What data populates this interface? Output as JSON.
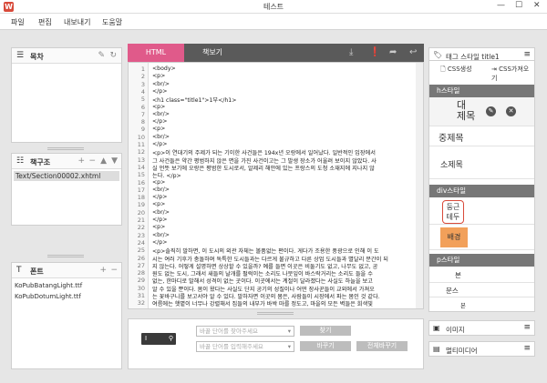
{
  "window": {
    "title": "테스트",
    "controls": [
      "—",
      "☐",
      "✕"
    ]
  },
  "menu": [
    "파일",
    "편집",
    "내보내기",
    "도움말"
  ],
  "toc": {
    "title": "목차"
  },
  "book": {
    "title": "책구조",
    "file": "Text/Section00002.xhtml"
  },
  "fonts": {
    "title": "폰트",
    "items": [
      "KoPubBatangLight.ttf",
      "KoPubDotumLight.ttf"
    ]
  },
  "editor": {
    "tabs": [
      "HTML",
      "책보기"
    ],
    "lines": [
      "<body>",
      "  <p>",
      "    <br/>",
      "  </p>",
      "  <h1 class=\"title1\">1부</h1>",
      "  <p>",
      "    <br/>",
      "  </p>",
      "  <p>",
      "    <br/>",
      "  </p>",
      "  <p>이 연대기의 주제가 되는 기이한 사건들은 194x년 오랑에서 일어났다. 일반적인 입장에서",
      "  그 사건들은 약간 평범하지 않은 면을 가진 사건이고는 그 발생 장소가 어울려 보이지 않았다. 사",
      "  실 언뜻 보기에 오랑은 평범한 도시로서, 알제리 해안에 있는 프랑스의 도청 소재지에 지나지 않",
      "  는다. </p>",
      "  <p>",
      "    <br/>",
      "  </p>",
      "  <p>",
      "    <br/>",
      "  </p>",
      "  <p>",
      "    <br/>",
      "  </p>",
      "  <p>솔직히 말하면, 이 도시의 외관 자체는 볼품없는 편이다. 게다가 조용한 풍광으로 인해 이 도",
      "  시는 여러 기후가 충돌하며 독특한 도시들과는 다르게 불규하고 다른 상업 도시들과 별달리 분간이 되",
      "  지 않는다. 어떻게 설명하면 상상할 수 있을까? 예를 들면 이곳은 비둘기도 없고, 나무도 없고, 공",
      "  원도 없는 도시, 그래서 새들의 날개를 펄럭이는 소리도 나뭇잎이 바스락거리는 소리도 들을 수",
      "  없는, 한마디로 말해서 성격이 없는 곳이다. 이곳에서는 계절이 달라졌다는 사실도 하늘을 보고",
      "  알 수 있을 뿐이다. 봄이 왔다는 사실도 단지 공기의 성질이나 어떤 장사꾼들이 교외에서 가져오",
      "  는 꽃바구니를 보고서야 알 수 있다. 말하자면 이곳의 봄은, 사람들이 시장에서 파는 봄인 것 같다.",
      "  여름에는 햇볕이 너무나 강렬해서 집들의 내부가 바싹 마를 정도고, 마을의 모든 벽들은 희색빛"
    ]
  },
  "search": {
    "label": "I",
    "find_placeholder": "바꿀 단어를 찾아주세요",
    "replace_placeholder": "바꿀 단어를 입력해주세요",
    "find_btn": "찾기",
    "replace_btn": "바꾸기",
    "replace_all_btn": "전체바꾸기"
  },
  "styles": {
    "tag_title": "태그 스타일 title1",
    "css_create": "CSS생성",
    "css_import": "CSS가져오기",
    "h_section": "h스타일",
    "h_items": [
      "대\n제목",
      "중제목",
      "소제목"
    ],
    "div_section": "div스타일",
    "div_items": [
      "둥근\n테두",
      "배경"
    ],
    "p_section": "p스타일",
    "p_items": [
      "본",
      "문스",
      "본"
    ]
  },
  "image_panel": "이미지",
  "media_panel": "멀티미디어",
  "colors": {
    "accent": "#e05a8a",
    "logo": "#d84a3a",
    "orange": "#f2a05a",
    "red_border": "#d94a3a"
  }
}
